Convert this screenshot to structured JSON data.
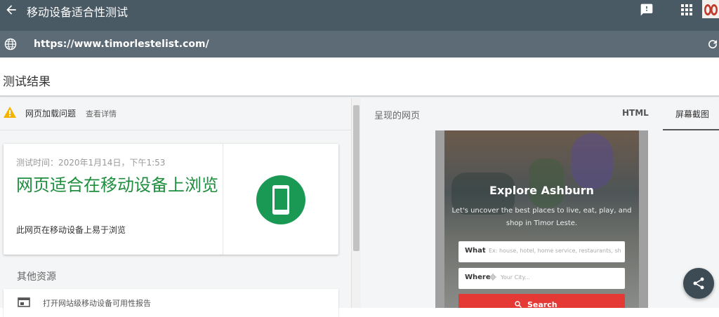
{
  "appbar": {
    "title": "移动设备适合性测试"
  },
  "urlbar": {
    "url": "https://www.timorlestelist.com/"
  },
  "results": {
    "title": "测试结果"
  },
  "left": {
    "warning": {
      "title": "网页加载问题",
      "link": "查看详情"
    },
    "card": {
      "time": "测试时间：2020年1月14日，下午1:53",
      "headline": "网页适合在移动设备上浏览",
      "subtext": "此网页在移动设备上易于浏览"
    },
    "other_resources_label": "其他资源",
    "report_link": "打开网站级移动设备可用性报告"
  },
  "right": {
    "heading": "呈现的网页",
    "tabs": [
      {
        "label": "HTML"
      },
      {
        "label": "屏幕截图"
      }
    ],
    "screenshot": {
      "title": "Explore Ashburn",
      "lead": "Let's uncover the best places to live, eat, play, and shop in Timor Leste.",
      "what_label": "What",
      "what_placeholder": "Ex: house, hotel, home service, restaurants, sh",
      "where_label": "Where",
      "where_placeholder": "Your City...",
      "search_label": "Search"
    }
  },
  "colors": {
    "appbar": "#4a5a64",
    "urlbar": "#5c6b75",
    "success": "#1e8e3e",
    "search_button": "#e53935"
  }
}
